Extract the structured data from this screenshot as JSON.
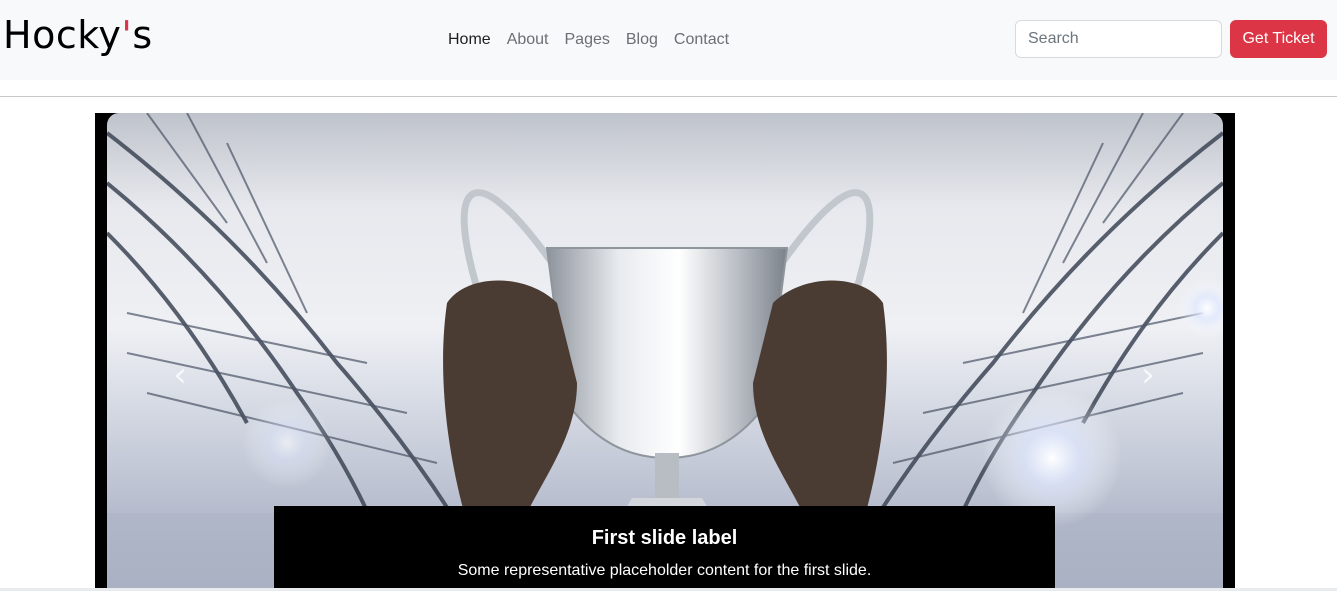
{
  "brand": {
    "name": "Hocky",
    "apostrophe": "'",
    "suffix": "s"
  },
  "nav": {
    "items": [
      {
        "label": "Home",
        "active": true
      },
      {
        "label": "About",
        "active": false
      },
      {
        "label": "Pages",
        "active": false
      },
      {
        "label": "Blog",
        "active": false
      },
      {
        "label": "Contact",
        "active": false
      }
    ]
  },
  "search": {
    "placeholder": "Search",
    "value": ""
  },
  "ticket_button": {
    "label": "Get Ticket"
  },
  "carousel": {
    "slide_image": "trophy-held-in-stadium",
    "prev_icon": "chevron-left-icon",
    "next_icon": "chevron-right-icon",
    "prev_glyph": "‹",
    "next_glyph": "›",
    "caption": {
      "title": "First slide label",
      "text": "Some representative placeholder content for the first slide."
    }
  },
  "colors": {
    "accent": "#dc3545",
    "navbar_bg": "#f8f9fa",
    "caption_bg": "#000000"
  }
}
